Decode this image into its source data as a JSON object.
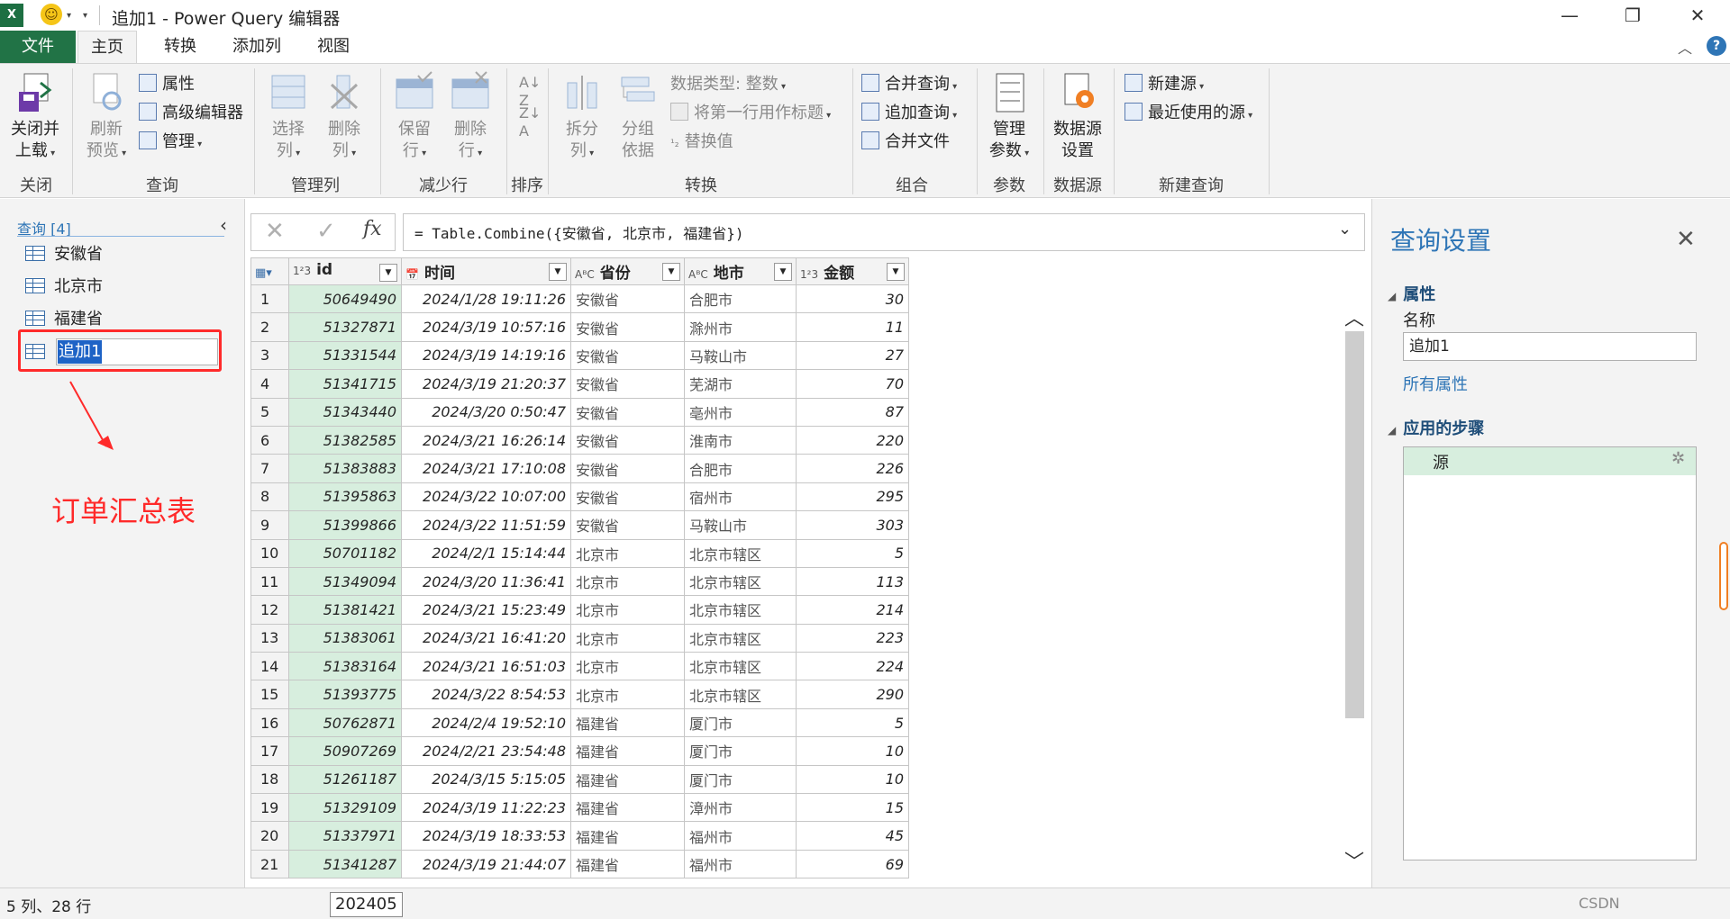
{
  "window": {
    "title": "追加1 - Power Query 编辑器",
    "excel_logo": "X",
    "min": "—",
    "restore": "❐",
    "close": "✕"
  },
  "tabs": [
    "文件",
    "主页",
    "转换",
    "添加列",
    "视图"
  ],
  "ribbon": {
    "close_group": {
      "btn": [
        "关闭并",
        "上载"
      ],
      "label": "关闭"
    },
    "query_group": {
      "refresh": [
        "刷新",
        "预览"
      ],
      "properties": "属性",
      "advanced_editor": "高级编辑器",
      "manage": "管理",
      "label": "查询"
    },
    "manage_cols": {
      "select": [
        "选择",
        "列"
      ],
      "remove": [
        "删除",
        "列"
      ],
      "label": "管理列"
    },
    "reduce_rows": {
      "keep": [
        "保留",
        "行"
      ],
      "remove": [
        "删除",
        "行"
      ],
      "label": "减少行"
    },
    "sort": {
      "label": "排序"
    },
    "transform": {
      "split": [
        "拆分",
        "列"
      ],
      "group": [
        "分组",
        "依据"
      ],
      "data_type": "数据类型: 整数",
      "first_row_header": "将第一行用作标题",
      "replace": "替换值",
      "label": "转换"
    },
    "combine": {
      "merge": "合并查询",
      "append": "追加查询",
      "combine_files": "合并文件",
      "label": "组合"
    },
    "params": {
      "manage": [
        "管理",
        "参数"
      ],
      "label": "参数"
    },
    "datasource": {
      "settings": [
        "数据源",
        "设置"
      ],
      "label": "数据源"
    },
    "newquery": {
      "new_source": "新建源",
      "recent": "最近使用的源",
      "label": "新建查询"
    }
  },
  "queries": {
    "header": "查询 [4]",
    "items": [
      "安徽省",
      "北京市",
      "福建省"
    ],
    "selected": "追加1",
    "annotation": "订单汇总表"
  },
  "formula": {
    "cancel": "✕",
    "confirm": "✓",
    "fx": "fx",
    "text": "= Table.Combine({安徽省, 北京市, 福建省})"
  },
  "table": {
    "columns": [
      {
        "type": "1²3",
        "name": "id"
      },
      {
        "type": "📅",
        "name": "时间"
      },
      {
        "type": "AᴮC",
        "name": "省份"
      },
      {
        "type": "AᴮC",
        "name": "地市"
      },
      {
        "type": "1²3",
        "name": "金额"
      }
    ],
    "rows": [
      [
        "1",
        "50649490",
        "2024/1/28 19:11:26",
        "安徽省",
        "合肥市",
        "30"
      ],
      [
        "2",
        "51327871",
        "2024/3/19 10:57:16",
        "安徽省",
        "滁州市",
        "11"
      ],
      [
        "3",
        "51331544",
        "2024/3/19 14:19:16",
        "安徽省",
        "马鞍山市",
        "27"
      ],
      [
        "4",
        "51341715",
        "2024/3/19 21:20:37",
        "安徽省",
        "芜湖市",
        "70"
      ],
      [
        "5",
        "51343440",
        "2024/3/20 0:50:47",
        "安徽省",
        "亳州市",
        "87"
      ],
      [
        "6",
        "51382585",
        "2024/3/21 16:26:14",
        "安徽省",
        "淮南市",
        "220"
      ],
      [
        "7",
        "51383883",
        "2024/3/21 17:10:08",
        "安徽省",
        "合肥市",
        "226"
      ],
      [
        "8",
        "51395863",
        "2024/3/22 10:07:00",
        "安徽省",
        "宿州市",
        "295"
      ],
      [
        "9",
        "51399866",
        "2024/3/22 11:51:59",
        "安徽省",
        "马鞍山市",
        "303"
      ],
      [
        "10",
        "50701182",
        "2024/2/1 15:14:44",
        "北京市",
        "北京市辖区",
        "5"
      ],
      [
        "11",
        "51349094",
        "2024/3/20 11:36:41",
        "北京市",
        "北京市辖区",
        "113"
      ],
      [
        "12",
        "51381421",
        "2024/3/21 15:23:49",
        "北京市",
        "北京市辖区",
        "214"
      ],
      [
        "13",
        "51383061",
        "2024/3/21 16:41:20",
        "北京市",
        "北京市辖区",
        "223"
      ],
      [
        "14",
        "51383164",
        "2024/3/21 16:51:03",
        "北京市",
        "北京市辖区",
        "224"
      ],
      [
        "15",
        "51393775",
        "2024/3/22 8:54:53",
        "北京市",
        "北京市辖区",
        "290"
      ],
      [
        "16",
        "50762871",
        "2024/2/4 19:52:10",
        "福建省",
        "厦门市",
        "5"
      ],
      [
        "17",
        "50907269",
        "2024/2/21 23:54:48",
        "福建省",
        "厦门市",
        "10"
      ],
      [
        "18",
        "51261187",
        "2024/3/15 5:15:05",
        "福建省",
        "厦门市",
        "10"
      ],
      [
        "19",
        "51329109",
        "2024/3/19 11:22:23",
        "福建省",
        "漳州市",
        "15"
      ],
      [
        "20",
        "51337971",
        "2024/3/19 18:33:53",
        "福建省",
        "福州市",
        "45"
      ],
      [
        "21",
        "51341287",
        "2024/3/19 21:44:07",
        "福建省",
        "福州市",
        "69"
      ]
    ]
  },
  "settings": {
    "title": "查询设置",
    "close": "✕",
    "properties_header": "属性",
    "name_label": "名称",
    "name_value": "追加1",
    "all_properties": "所有属性",
    "steps_header": "应用的步骤",
    "steps": [
      "源"
    ]
  },
  "status": {
    "left": "5 列、28 行",
    "tooltip": "202405",
    "watermark": "CSDN"
  },
  "colors": {
    "accent_green": "#217346",
    "highlight_red": "#ff2a2a",
    "link_blue": "#2e75b6",
    "id_column_bg": "#d7eede"
  }
}
